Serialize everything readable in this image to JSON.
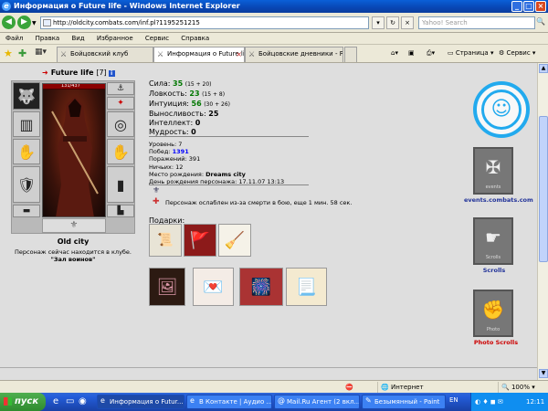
{
  "window": {
    "title": "Информация о Future life - Windows Internet Explorer"
  },
  "address": {
    "url": "http://oldcity.combats.com/inf.pl?1195251215",
    "search_placeholder": "Yahoo! Search"
  },
  "menu": [
    "Файл",
    "Правка",
    "Вид",
    "Избранное",
    "Сервис",
    "Справка"
  ],
  "tabs": [
    {
      "label": "Бойцовский клуб",
      "active": false
    },
    {
      "label": "Информация о Future life",
      "active": true
    },
    {
      "label": "Бойцовские дневники - Fut...",
      "active": false
    }
  ],
  "commands": {
    "page": "Страница",
    "tools": "Сервис"
  },
  "character": {
    "name": "Future life",
    "level": "[7]",
    "hp": "131/437",
    "location_city": "Old city",
    "location_msg": "Персонаж сейчас находится в клубе.",
    "location_room": "\"Зал воинов\""
  },
  "stats": [
    {
      "label": "Сила:",
      "value": "35",
      "extra": "(15 + 20)"
    },
    {
      "label": "Ловкость:",
      "value": "23",
      "extra": "(15 + 8)"
    },
    {
      "label": "Интуиция:",
      "value": "56",
      "extra": "(30 + 26)"
    },
    {
      "label": "Выносливость:",
      "value": "25",
      "extra": ""
    },
    {
      "label": "Интеллект:",
      "value": "0",
      "extra": ""
    },
    {
      "label": "Мудрость:",
      "value": "0",
      "extra": ""
    }
  ],
  "info": {
    "level_label": "Уровень:",
    "level_value": "7",
    "wins_label": "Побед:",
    "wins_value": "1391",
    "losses_label": "Поражений:",
    "losses_value": "391",
    "draws_label": "Ничьих:",
    "draws_value": "12",
    "birthplace_label": "Место рождения:",
    "birthplace_value": "Dreams city",
    "birthday_label": "День рождения персонажа:",
    "birthday_value": "17.11.07 13:13"
  },
  "effect_text": "Персонаж ослаблен из-за смерти в бою, еще 1 мин. 58 сек.",
  "gifts_label": "Подарки:",
  "sidebar": {
    "events_label": "events.combats.com",
    "scrolls_label": "Scrolls",
    "photo_label": "Photo Scrolls",
    "events_band": "events",
    "scrolls_band": "Scrolls",
    "photo_band": "Photo"
  },
  "statusbar": {
    "zone": "Интернет",
    "zoom": "100%"
  },
  "taskbar": {
    "start": "пуск",
    "buttons": [
      "Информация о Futur...",
      "В Контакте | Аудио ...",
      "Mail.Ru Агент (2 вкл...",
      "Безымянный - Paint"
    ],
    "lang": "EN",
    "time": "12:11"
  },
  "colors": {
    "accent_stat": "#007700",
    "wins": "#0000ff",
    "photo_label": "#cc0000",
    "link": "#223399"
  }
}
